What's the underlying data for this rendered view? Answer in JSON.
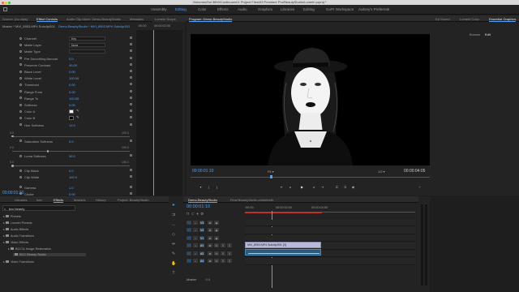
{
  "app": {
    "window_title": "/Volumes/Sol 3800/Continuum01 Project Files/03 Premiere Pro/BeautyStudio/Lumetri.prproj *",
    "traffic_lights": [
      "#ff5f57",
      "#febc2e",
      "#28c840"
    ]
  },
  "workspaces": {
    "items": [
      "Assembly",
      "Editing",
      "Color",
      "Effects",
      "Audio",
      "Graphics",
      "Libraries",
      "Editing",
      "GoPr Workspace",
      "Aubrey's Preferred"
    ],
    "active_index": 1
  },
  "effect_controls": {
    "tabs": [
      "Source: (no clips)",
      "Effect Controls",
      "Audio Clip Mixer: Demo-BeautyStudio",
      "Metadata"
    ],
    "master_label": "Master * MVI_8953.MP4 SubclipS01",
    "sequence_label": "Demo-BeautyStudio * MVI_8953.MP4 SubclipS01",
    "time_start": ":00:00",
    "time_end": "00:00:02:00",
    "rows": [
      {
        "label": "Channel",
        "dropdown": "Key"
      },
      {
        "label": "Matte Layer",
        "dropdown": "None"
      },
      {
        "label": "Matte Type",
        "dropdown": ""
      },
      {
        "label": "Pre Smoothing Amount",
        "value": "0.0"
      },
      {
        "label": "Preserve Contrast",
        "value": "40.00"
      },
      {
        "label": "Black Level",
        "value": "0.00"
      },
      {
        "label": "White Level",
        "value": "100.00"
      },
      {
        "label": "Threshold",
        "value": "0.00"
      },
      {
        "label": "Range From",
        "value": "0.00"
      },
      {
        "label": "Range To",
        "value": "100.00"
      },
      {
        "label": "Softness",
        "value": "0.00"
      },
      {
        "label": "Color A",
        "swatch": "#ffffff"
      },
      {
        "label": "Color B",
        "swatch": "#000000"
      },
      {
        "label": "Hue Softness",
        "value": "12.0"
      }
    ],
    "slider_rows": [
      {
        "scale_min": "0.0",
        "scale_max": "100.0",
        "label": "Saturation Softness",
        "value": "0.0"
      },
      {
        "scale_min": "0.0",
        "scale_max": "100.0",
        "label": "Luma Softness",
        "value": "30.0"
      },
      {
        "scale_min": "0.0",
        "scale_max": "100.0",
        "label": "Clip Black",
        "value": "0.0"
      },
      {
        "label": "Clip White",
        "value": "100.0"
      }
    ],
    "bottom_rows": [
      {
        "label": "Gamma",
        "value": "1.0"
      },
      {
        "label": "Choke",
        "value": "0.00"
      },
      {
        "label": "Blur",
        "value": "0.00"
      }
    ],
    "footer_time": "00:00:01:10"
  },
  "lumetri_tab": "Lumetri Scope",
  "program": {
    "tab": "Program: Demo-BeautyStudio",
    "timecode_current": "00:00:01:10",
    "fit": "Fit",
    "ratio": "1/2",
    "timecode_duration": "00:00:04:05"
  },
  "right_panel": {
    "tabs": [
      "Ed Sound",
      "Lumetri Color",
      "Essential Graphics"
    ],
    "subtabs": [
      "Browse",
      "Edit"
    ]
  },
  "project_panel": {
    "tabs": [
      "Libraries",
      "Info",
      "Effects",
      "Markers",
      "History",
      "Project: BeautyStudio"
    ],
    "search_value": "bcc beauty",
    "items": [
      {
        "label": "Presets",
        "indent": 0
      },
      {
        "label": "Lumetri Presets",
        "indent": 0
      },
      {
        "label": "Audio Effects",
        "indent": 0
      },
      {
        "label": "Audio Transitions",
        "indent": 0
      },
      {
        "label": "Video Effects",
        "indent": 0
      },
      {
        "label": "BCC11 Image Restoration",
        "indent": 1
      },
      {
        "label": "BCC Beauty Studio",
        "indent": 2
      },
      {
        "label": "Video Transitions",
        "indent": 0
      }
    ]
  },
  "timeline": {
    "tabs": [
      "Demo-BeautyStudio",
      "Final BeautyStudio-whiteteeth"
    ],
    "timecode": "00:00:01:10",
    "ruler": [
      ":00:00",
      "00:00:02:00",
      "00:00:04:00"
    ],
    "tracks": [
      {
        "name": "V3"
      },
      {
        "name": "V2"
      },
      {
        "name": "V1"
      },
      {
        "name": "A1"
      },
      {
        "name": "A2"
      },
      {
        "name": "A3"
      }
    ],
    "master": {
      "label": "Master",
      "value": "0.0"
    },
    "video_clip": "MVI_8953.MP4 SubclipS01 [V]",
    "audio_clip": ""
  }
}
